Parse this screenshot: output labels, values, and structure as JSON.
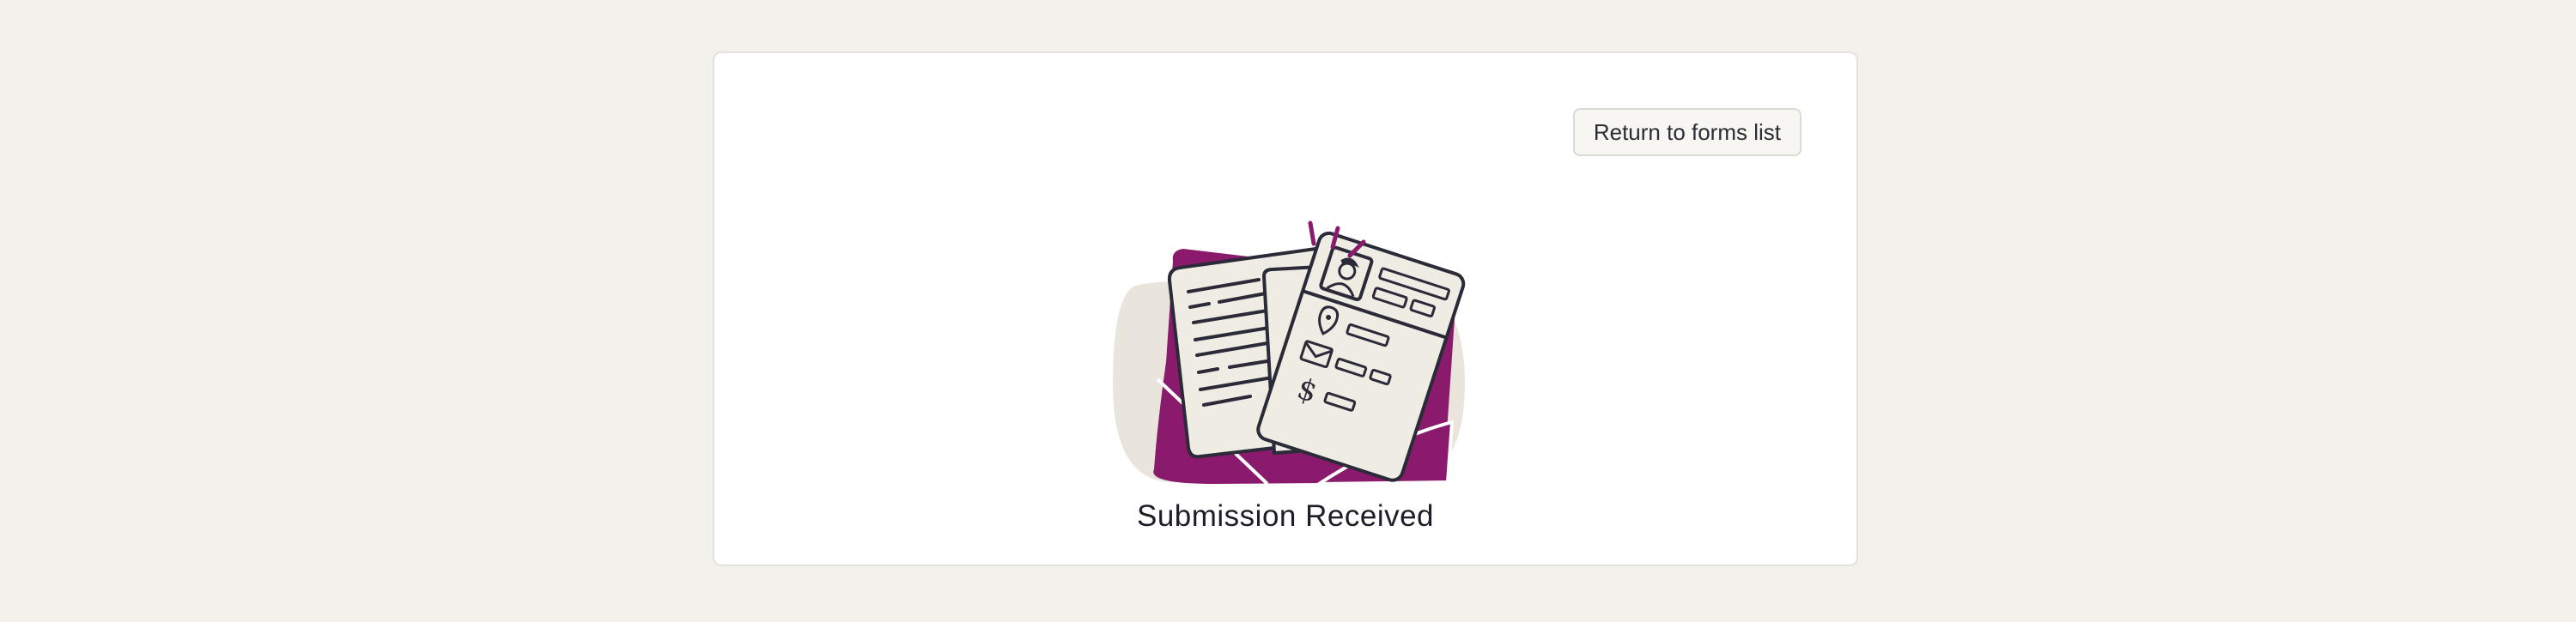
{
  "actions": {
    "return_label": "Return to forms list"
  },
  "confirmation": {
    "title": "Submission Received"
  },
  "colors": {
    "page_background": "#f3f1ec",
    "card_background": "#ffffff",
    "accent_purple": "#8a1a6c",
    "blob_beige": "#e9e5dc",
    "paper": "#efece4",
    "ink": "#2b2a38"
  },
  "icons": {
    "illustration": "documents-envelope-illustration"
  }
}
